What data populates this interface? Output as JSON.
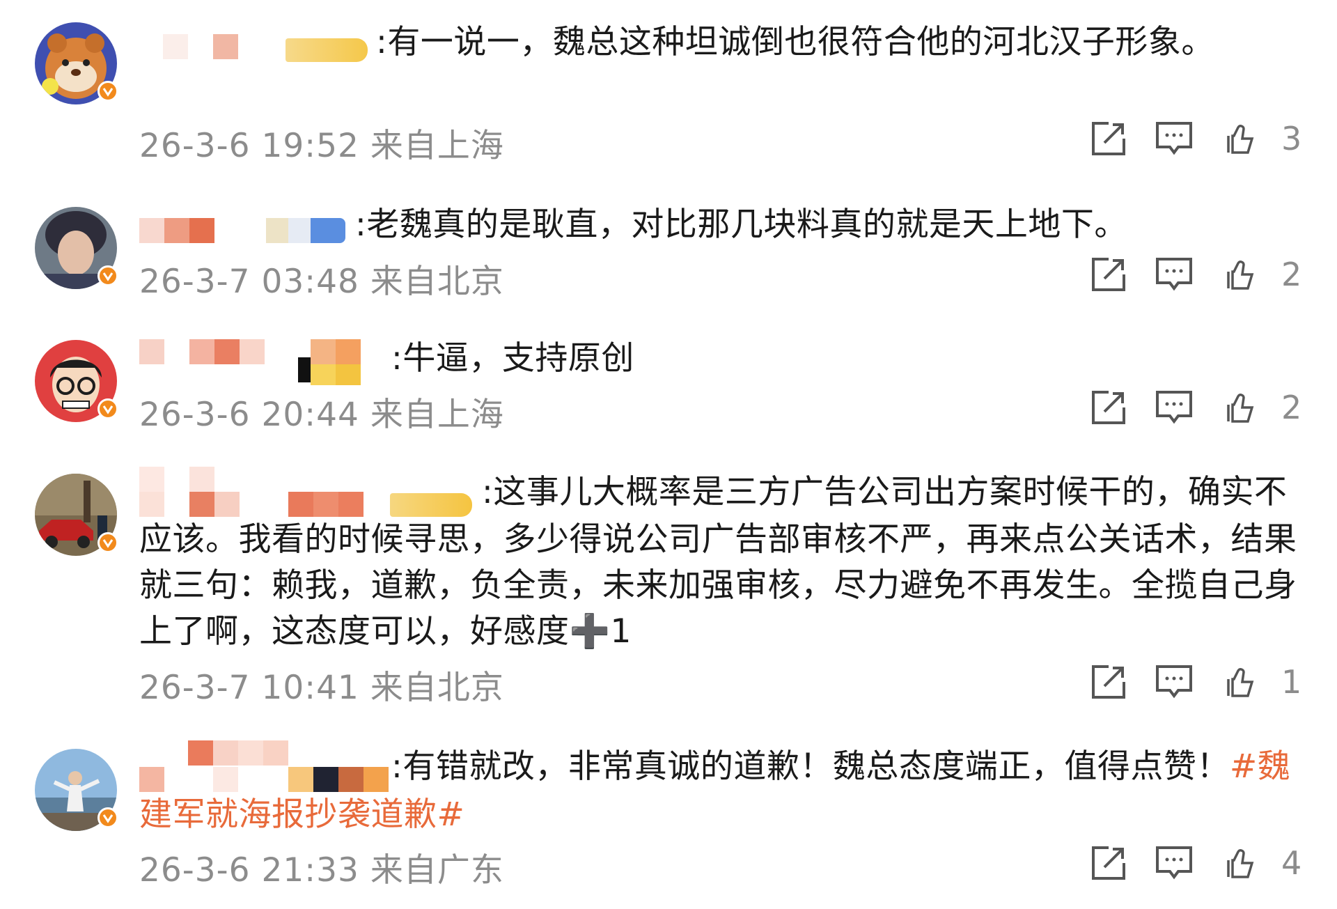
{
  "comments": [
    {
      "text": ":有一说一，魏总这种坦诚倒也很符合他的河北汉子形象。",
      "hashtag": "",
      "time": "26-3-6 19:52 来自上海",
      "likes": "3",
      "avatar": "cartoon-bear-avatar"
    },
    {
      "text": ":老魏真的是耿直，对比那几块料真的就是天上地下。",
      "hashtag": "",
      "time": "26-3-7 03:48 来自北京",
      "likes": "2",
      "avatar": "person-hood-avatar"
    },
    {
      "text": ":牛逼，支持原创",
      "hashtag": "",
      "time": "26-3-6 20:44 来自上海",
      "likes": "2",
      "avatar": "cartoon-glasses-avatar"
    },
    {
      "text": ":这事儿大概率是三方广告公司出方案时候干的，确实不应该。我看的时候寻思，多少得说公司广告部审核不严，再来点公关话术，结果就三句：赖我，道歉，负全责，未来加强审核，尽力避免不再发生。全揽自己身上了啊，这态度可以，好感度➕1",
      "hashtag": "",
      "time": "26-3-7 10:41 来自北京",
      "likes": "1",
      "avatar": "car-photo-avatar"
    },
    {
      "text": ":有错就改，非常真诚的道歉！魏总态度端正，值得点赞！",
      "hashtag": "#魏建军就海报抄袭道歉#",
      "time": "26-3-6 21:33 来自广东",
      "likes": "4",
      "avatar": "person-seaside-avatar"
    }
  ],
  "colors": {
    "meta_gray": "#8c8c8c",
    "hashtag": "#e86a3a",
    "verified_badge": "#f28a1c"
  },
  "icons": [
    "share-icon",
    "comment-icon",
    "like-icon",
    "verified-badge-icon"
  ]
}
